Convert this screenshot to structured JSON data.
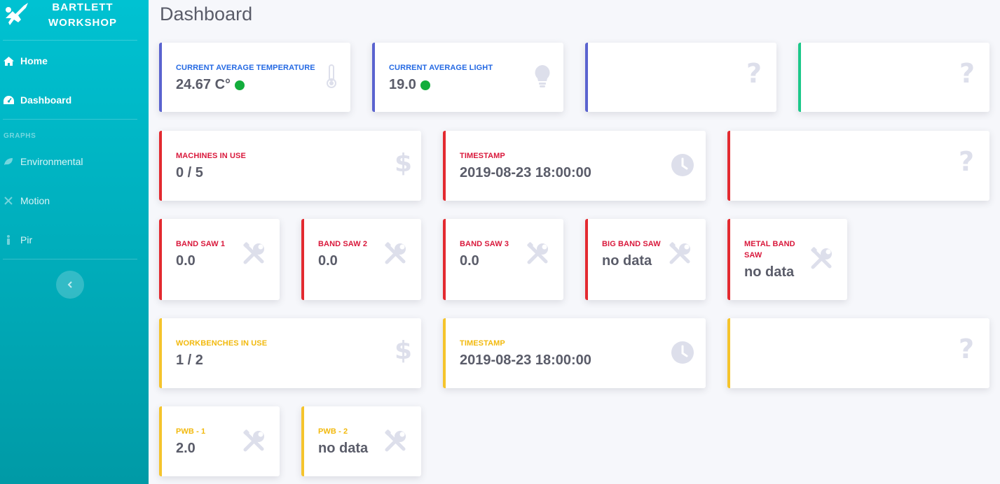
{
  "sidebar": {
    "brand": "BARTLETT\nWORKSHOP",
    "items": [
      {
        "label": "Home",
        "icon": "home-icon"
      },
      {
        "label": "Dashboard",
        "icon": "dashboard-icon"
      },
      {
        "label": "Environmental",
        "icon": "leaf-icon"
      },
      {
        "label": "Motion",
        "icon": "arrows-icon"
      },
      {
        "label": "Pir",
        "icon": "person-icon"
      }
    ],
    "section_graphs": "GRAPHS"
  },
  "page_title": "Dashboard",
  "colors": {
    "blue": "#5a63cf",
    "green": "#1cc88a",
    "red": "#e32a30",
    "yellow": "#f5c42c",
    "status_ok": "#13ad3c"
  },
  "cards": {
    "temperature": {
      "label": "CURRENT AVERAGE TEMPERATURE",
      "value": "24.67 C°",
      "icon": "thermometer-icon"
    },
    "light": {
      "label": "CURRENT AVERAGE LIGHT",
      "value": "19.0",
      "icon": "lightbulb-icon"
    },
    "unknown1": {
      "icon": "question-icon",
      "glyph": "?"
    },
    "unknown2": {
      "icon": "question-icon",
      "glyph": "?"
    },
    "machines": {
      "label": "MACHINES IN USE",
      "value": "0 / 5",
      "icon": "dollar-icon",
      "glyph": "$"
    },
    "machines_timestamp": {
      "label": "TIMESTAMP",
      "value": "2019-08-23 18:00:00",
      "icon": "clock-icon"
    },
    "unknown3": {
      "icon": "question-icon",
      "glyph": "?"
    },
    "band_saw_1": {
      "label": "BAND SAW 1",
      "value": "0.0",
      "icon": "tools-icon"
    },
    "band_saw_2": {
      "label": "BAND SAW 2",
      "value": "0.0",
      "icon": "tools-icon"
    },
    "band_saw_3": {
      "label": "BAND SAW 3",
      "value": "0.0",
      "icon": "tools-icon"
    },
    "big_band_saw": {
      "label": "BIG BAND SAW",
      "value": "no data",
      "icon": "tools-icon"
    },
    "metal_band_saw": {
      "label": "METAL BAND SAW",
      "value": "no data",
      "icon": "tools-icon"
    },
    "workbenches": {
      "label": "WORKBENCHES IN USE",
      "value": "1 / 2",
      "icon": "dollar-icon",
      "glyph": "$"
    },
    "workbenches_timestamp": {
      "label": "TIMESTAMP",
      "value": "2019-08-23 18:00:00",
      "icon": "clock-icon"
    },
    "unknown4": {
      "icon": "question-icon",
      "glyph": "?"
    },
    "pwb_1": {
      "label": "PWB - 1",
      "value": "2.0",
      "icon": "tools-icon"
    },
    "pwb_2": {
      "label": "PWB - 2",
      "value": "no data",
      "icon": "tools-icon"
    }
  }
}
